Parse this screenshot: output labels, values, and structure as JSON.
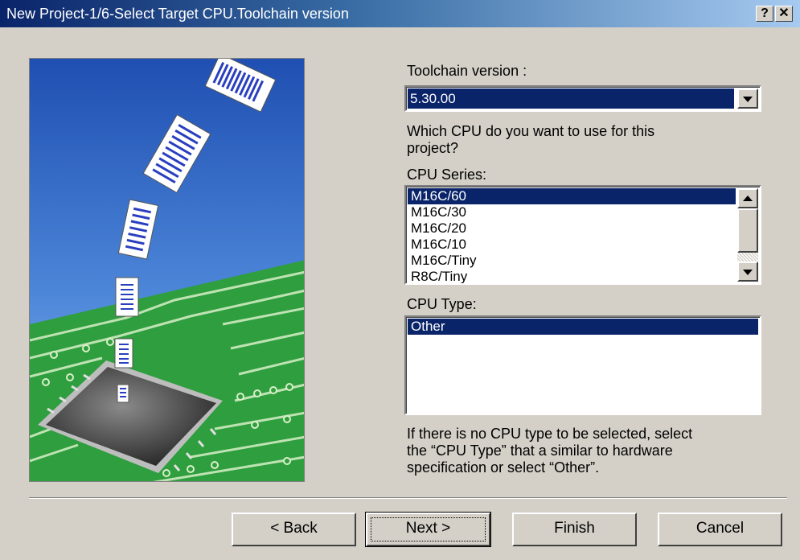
{
  "window": {
    "title": "New Project-1/6-Select Target CPU.Toolchain version",
    "help_label": "?",
    "close_label": "✕"
  },
  "toolchain": {
    "label": "Toolchain version :",
    "value": "5.30.00"
  },
  "cpu_question": {
    "line1": "Which CPU do you want to use for this",
    "line2": "project?"
  },
  "cpu_series": {
    "label": "CPU Series:",
    "items": [
      "M16C/60",
      "M16C/30",
      "M16C/20",
      "M16C/10",
      "M16C/Tiny",
      "R8C/Tiny"
    ],
    "selected": "M16C/60"
  },
  "cpu_type": {
    "label": "CPU Type:",
    "items": [
      "Other"
    ],
    "selected": "Other"
  },
  "hint": {
    "line1": "If there is no CPU type to be selected, select",
    "line2": "the “CPU Type” that a similar to hardware",
    "line3": "specification or select “Other”."
  },
  "buttons": {
    "back": "< Back",
    "next": "Next >",
    "finish": "Finish",
    "cancel": "Cancel"
  },
  "colors": {
    "selection": "#0a246a",
    "sky_top": "#1f4fb2",
    "board_green": "#2e9e3e"
  }
}
